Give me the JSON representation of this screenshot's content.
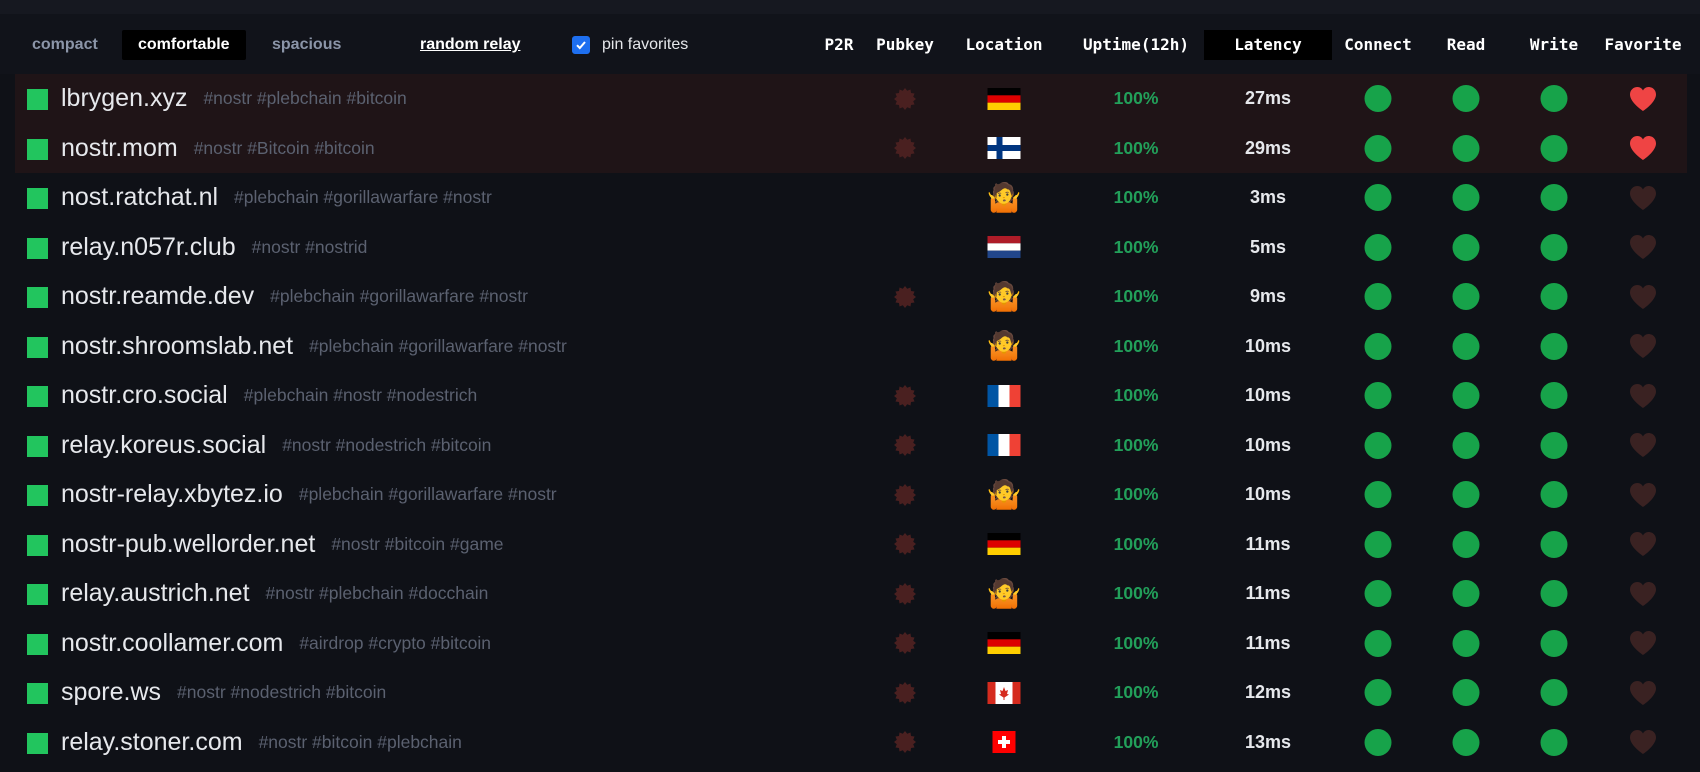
{
  "toolbar": {
    "density": [
      "compact",
      "comfortable",
      "spacious"
    ],
    "active_density": "comfortable",
    "random_relay": "random relay",
    "pin_favorites": {
      "label": "pin favorites",
      "checked": true
    }
  },
  "columns": {
    "p2r": "P2R",
    "pubkey": "Pubkey",
    "location": "Location",
    "uptime": "Uptime(12h)",
    "latency": "Latency",
    "connect": "Connect",
    "read": "Read",
    "write": "Write",
    "favorite": "Favorite"
  },
  "colors": {
    "status_square": "#22c55e",
    "status_dot": "#17a34a",
    "uptime": "#22a05a",
    "favorite_row": "#1f1417",
    "heart_on": "#ef4444",
    "heart_off": "#3a2222",
    "pubkey_icon": "#4a2020"
  },
  "relays": [
    {
      "name": "lbrygen.xyz",
      "tags": "#nostr #plebchain #bitcoin",
      "pubkey": true,
      "location": "de",
      "uptime": "100%",
      "latency": "27ms",
      "connect": true,
      "read": true,
      "write": true,
      "favorite": true
    },
    {
      "name": "nostr.mom",
      "tags": "#nostr #Bitcoin #bitcoin",
      "pubkey": true,
      "location": "fi",
      "uptime": "100%",
      "latency": "29ms",
      "connect": true,
      "read": true,
      "write": true,
      "favorite": true
    },
    {
      "name": "nost.ratchat.nl",
      "tags": "#plebchain #gorillawarfare #nostr",
      "pubkey": false,
      "location": "unknown",
      "uptime": "100%",
      "latency": "3ms",
      "connect": true,
      "read": true,
      "write": true,
      "favorite": false
    },
    {
      "name": "relay.n057r.club",
      "tags": "#nostr #nostrid",
      "pubkey": false,
      "location": "nl",
      "uptime": "100%",
      "latency": "5ms",
      "connect": true,
      "read": true,
      "write": true,
      "favorite": false
    },
    {
      "name": "nostr.reamde.dev",
      "tags": "#plebchain #gorillawarfare #nostr",
      "pubkey": true,
      "location": "unknown",
      "uptime": "100%",
      "latency": "9ms",
      "connect": true,
      "read": true,
      "write": true,
      "favorite": false
    },
    {
      "name": "nostr.shroomslab.net",
      "tags": "#plebchain #gorillawarfare #nostr",
      "pubkey": false,
      "location": "unknown",
      "uptime": "100%",
      "latency": "10ms",
      "connect": true,
      "read": true,
      "write": true,
      "favorite": false
    },
    {
      "name": "nostr.cro.social",
      "tags": "#plebchain #nostr #nodestrich",
      "pubkey": true,
      "location": "fr",
      "uptime": "100%",
      "latency": "10ms",
      "connect": true,
      "read": true,
      "write": true,
      "favorite": false
    },
    {
      "name": "relay.koreus.social",
      "tags": "#nostr #nodestrich #bitcoin",
      "pubkey": true,
      "location": "fr",
      "uptime": "100%",
      "latency": "10ms",
      "connect": true,
      "read": true,
      "write": true,
      "favorite": false
    },
    {
      "name": "nostr-relay.xbytez.io",
      "tags": "#plebchain #gorillawarfare #nostr",
      "pubkey": true,
      "location": "unknown",
      "uptime": "100%",
      "latency": "10ms",
      "connect": true,
      "read": true,
      "write": true,
      "favorite": false
    },
    {
      "name": "nostr-pub.wellorder.net",
      "tags": "#nostr #bitcoin #game",
      "pubkey": true,
      "location": "de",
      "uptime": "100%",
      "latency": "11ms",
      "connect": true,
      "read": true,
      "write": true,
      "favorite": false
    },
    {
      "name": "relay.austrich.net",
      "tags": "#nostr #plebchain #docchain",
      "pubkey": true,
      "location": "unknown",
      "uptime": "100%",
      "latency": "11ms",
      "connect": true,
      "read": true,
      "write": true,
      "favorite": false
    },
    {
      "name": "nostr.coollamer.com",
      "tags": "#airdrop #crypto #bitcoin",
      "pubkey": true,
      "location": "de",
      "uptime": "100%",
      "latency": "11ms",
      "connect": true,
      "read": true,
      "write": true,
      "favorite": false
    },
    {
      "name": "spore.ws",
      "tags": "#nostr #nodestrich #bitcoin",
      "pubkey": true,
      "location": "ca",
      "uptime": "100%",
      "latency": "12ms",
      "connect": true,
      "read": true,
      "write": true,
      "favorite": false
    },
    {
      "name": "relay.stoner.com",
      "tags": "#nostr #bitcoin #plebchain",
      "pubkey": true,
      "location": "ch",
      "uptime": "100%",
      "latency": "13ms",
      "connect": true,
      "read": true,
      "write": true,
      "favorite": false
    }
  ]
}
